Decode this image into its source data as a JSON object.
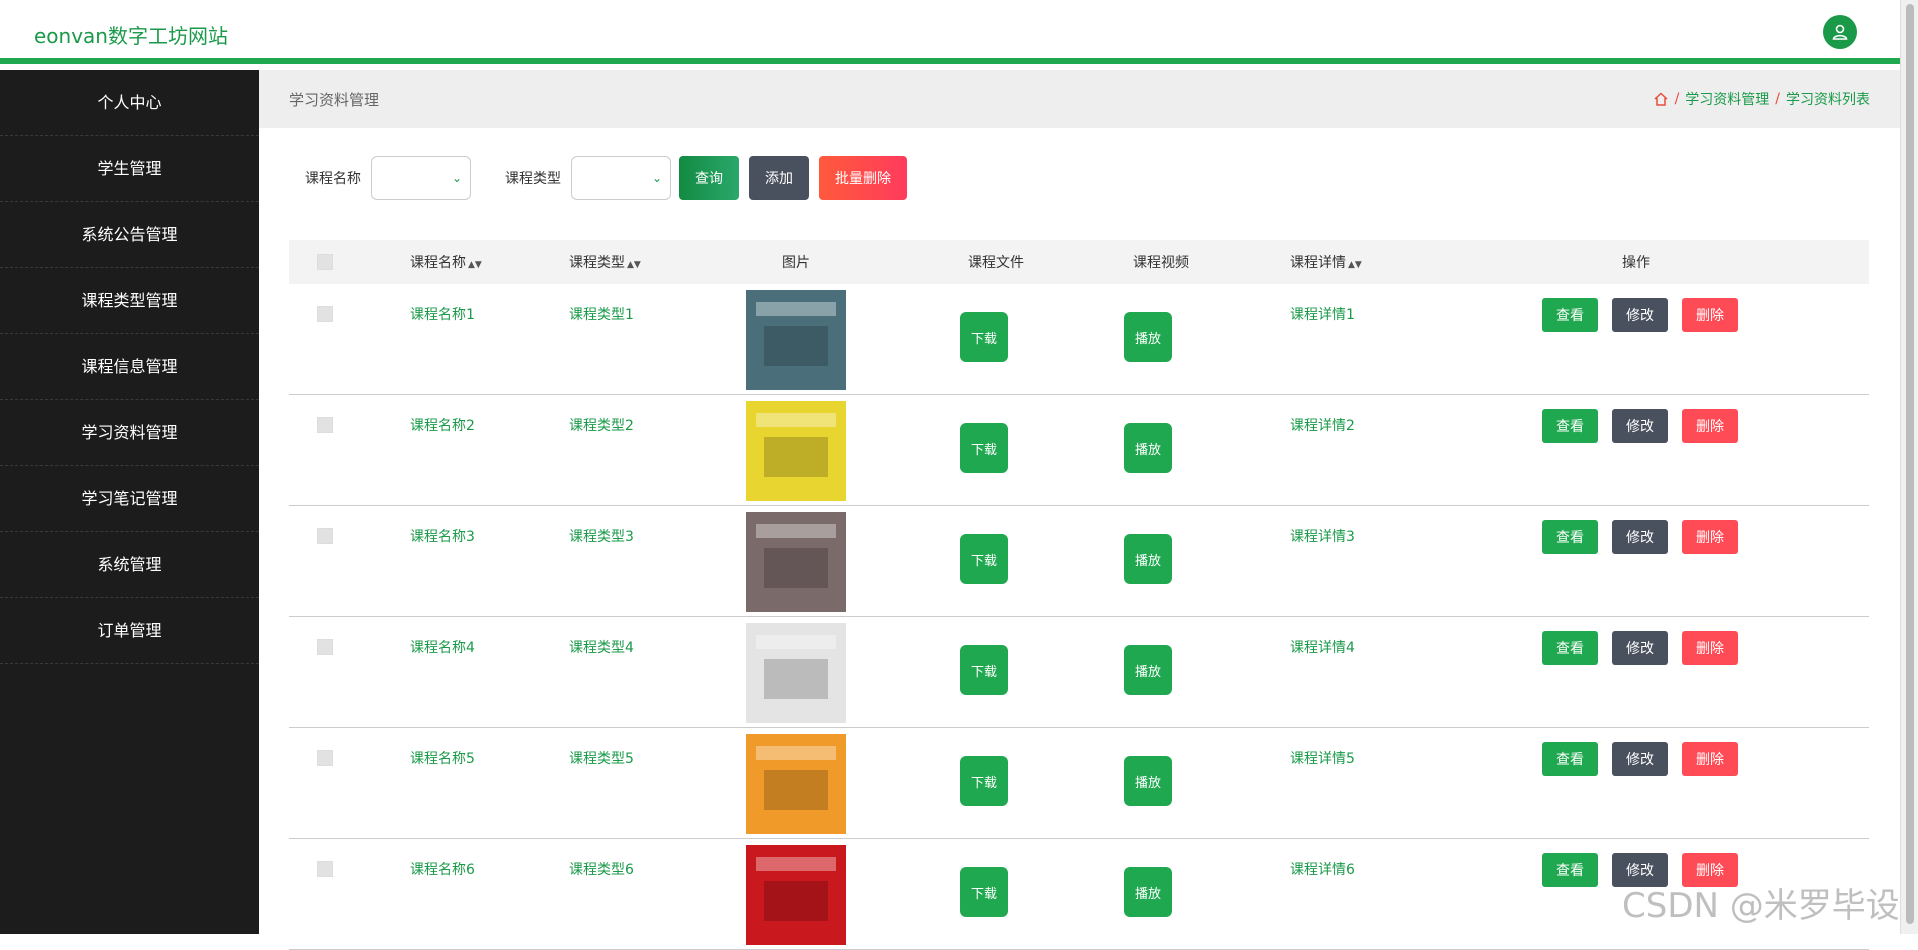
{
  "header": {
    "brand": "eonvan数字工坊网站"
  },
  "sidebar": {
    "items": [
      {
        "label": "个人中心"
      },
      {
        "label": "学生管理"
      },
      {
        "label": "系统公告管理"
      },
      {
        "label": "课程类型管理"
      },
      {
        "label": "课程信息管理"
      },
      {
        "label": "学习资料管理"
      },
      {
        "label": "学习笔记管理"
      },
      {
        "label": "系统管理"
      },
      {
        "label": "订单管理"
      }
    ]
  },
  "page": {
    "title": "学习资料管理",
    "breadcrumb": [
      "学习资料管理",
      "学习资料列表"
    ]
  },
  "filters": {
    "course_name_label": "课程名称",
    "course_type_label": "课程类型",
    "query_label": "查询",
    "add_label": "添加",
    "bulk_delete_label": "批量删除"
  },
  "table": {
    "headers": [
      "课程名称",
      "课程类型",
      "图片",
      "课程文件",
      "课程视频",
      "课程详情",
      "操作"
    ],
    "download_label": "下载",
    "play_label": "播放",
    "view_label": "查看",
    "edit_label": "修改",
    "delete_label": "删除",
    "rows": [
      {
        "name": "课程名称1",
        "type": "课程类型1",
        "detail": "课程详情1",
        "color": "#4a6f7a"
      },
      {
        "name": "课程名称2",
        "type": "课程类型2",
        "detail": "课程详情2",
        "color": "#e8d530"
      },
      {
        "name": "课程名称3",
        "type": "课程类型3",
        "detail": "课程详情3",
        "color": "#7b6a6a"
      },
      {
        "name": "课程名称4",
        "type": "课程类型4",
        "detail": "课程详情4",
        "color": "#e4e4e4"
      },
      {
        "name": "课程名称5",
        "type": "课程类型5",
        "detail": "课程详情5",
        "color": "#f09a2a"
      },
      {
        "name": "课程名称6",
        "type": "课程类型6",
        "detail": "课程详情6",
        "color": "#c9181e"
      }
    ]
  },
  "watermark": "CSDN @米罗毕设",
  "colors": {
    "accent": "#1fa84f",
    "sidebar": "#1c1c1c",
    "danger": "#ff4b55",
    "dark_button": "#49505e"
  }
}
